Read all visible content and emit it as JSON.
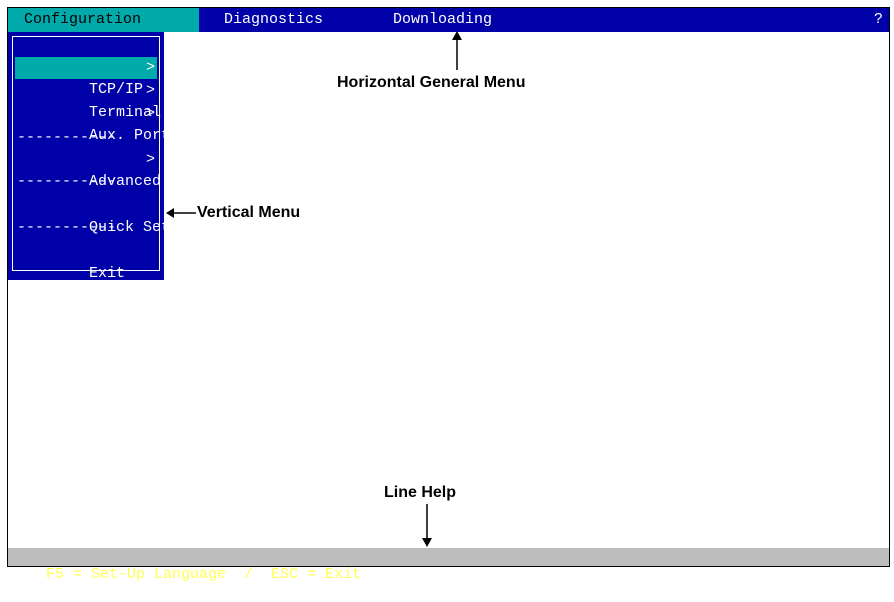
{
  "menubar": {
    "items": [
      {
        "label": "Configuration",
        "active": true
      },
      {
        "label": "Diagnostics"
      },
      {
        "label": "Downloading"
      }
    ],
    "help": "?"
  },
  "dropdown": {
    "items": [
      {
        "label": "TCP/IP",
        "arrow": ">"
      },
      {
        "label": "Terminal",
        "arrow": ">"
      },
      {
        "label": "Aux. Ports",
        "arrow": ">"
      },
      {
        "label": "Advanced",
        "arrow": ">"
      },
      {
        "label": "Quick Set-Up"
      },
      {
        "label": "Exit"
      }
    ],
    "separator": "-----------"
  },
  "annotations": {
    "horizontal": "Horizontal General Menu",
    "vertical": "Vertical Menu",
    "linehelp": "Line Help"
  },
  "status": {
    "text": "F5 = Set-Up Language  /  ESC = Exit"
  },
  "colors": {
    "menu_bg": "#0000a8",
    "highlight": "#00aaaa",
    "status_bg": "#bdbdbd",
    "status_fg": "#ffff55"
  }
}
